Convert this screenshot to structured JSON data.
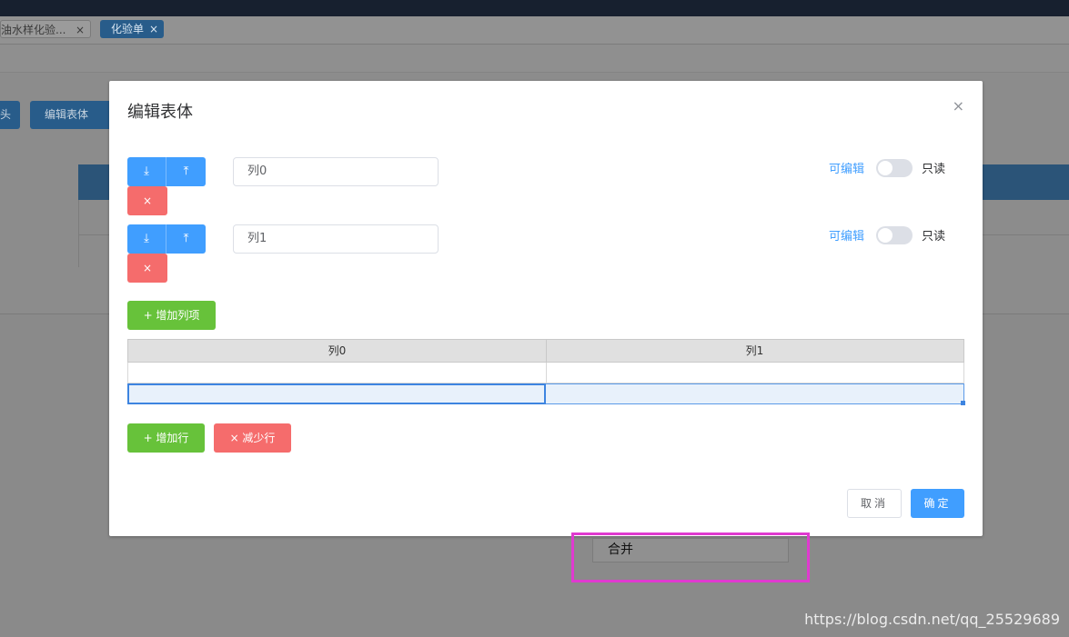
{
  "tabs": [
    {
      "label": "油水样化验...",
      "close": "×"
    },
    {
      "label": "化验单",
      "close": "×"
    }
  ],
  "background": {
    "button1_label": "头",
    "button2_label": "编辑表体"
  },
  "dialog": {
    "title": "编辑表体",
    "close_icon": "×",
    "columns": [
      {
        "value": "列0",
        "down_icon": "⤓",
        "up_icon": "⤒",
        "delete_icon": "×",
        "editable_label": "可编辑",
        "readonly_label": "只读",
        "editable": false
      },
      {
        "value": "列1",
        "down_icon": "⤓",
        "up_icon": "⤒",
        "delete_icon": "×",
        "editable_label": "可编辑",
        "readonly_label": "只读",
        "editable": false
      }
    ],
    "add_column_label": "+ 增加列项",
    "grid": {
      "headers": [
        "列0",
        "列1"
      ],
      "rows": [
        [
          "",
          ""
        ],
        [
          "",
          ""
        ]
      ]
    },
    "add_row_label": "+ 增加行",
    "remove_row_label": "× 减少行",
    "cancel_label": "取消",
    "confirm_label": "确定"
  },
  "context_menu": {
    "merge_label": "合并"
  },
  "watermark": "https://blog.csdn.net/qq_25529689"
}
